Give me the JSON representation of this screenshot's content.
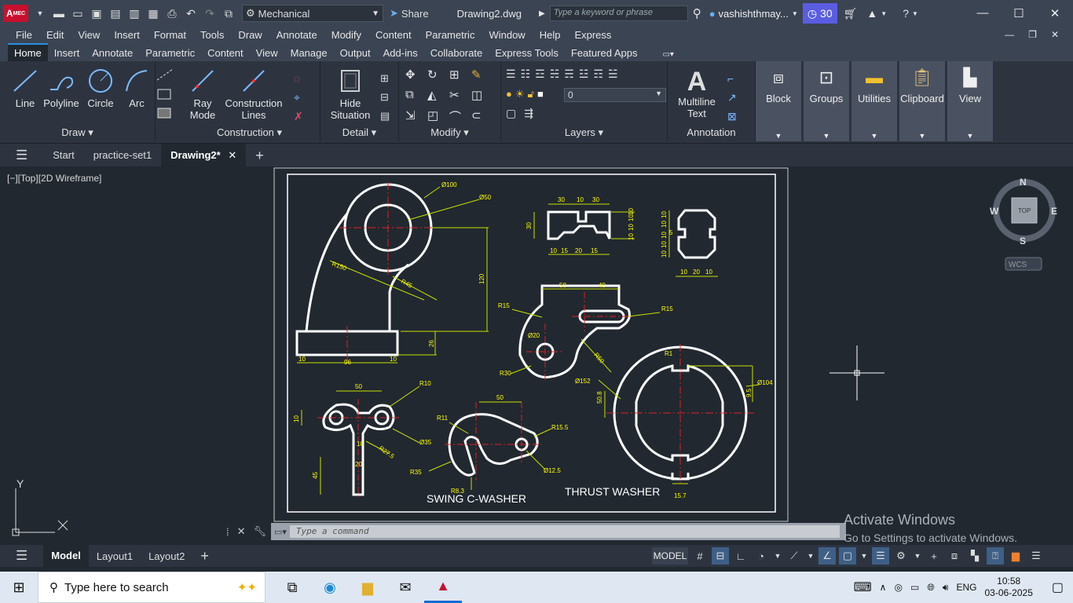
{
  "titlebar": {
    "app_badge": "A",
    "app_badge_sub": "MEC",
    "workspace": "Mechanical",
    "share_label": "Share",
    "doc_title": "Drawing2.dwg",
    "search_placeholder": "Type a keyword or phrase",
    "user_name": "vashishthmay...",
    "trial_days": "30"
  },
  "menubar": [
    "File",
    "Edit",
    "View",
    "Insert",
    "Format",
    "Tools",
    "Draw",
    "Annotate",
    "Modify",
    "Content",
    "Parametric",
    "Window",
    "Help",
    "Express"
  ],
  "ribbon_tabs": [
    "Home",
    "Insert",
    "Annotate",
    "Parametric",
    "Content",
    "View",
    "Manage",
    "Output",
    "Add-ins",
    "Collaborate",
    "Express Tools",
    "Featured Apps"
  ],
  "ribbon_active_tab": "Home",
  "ribbon": {
    "draw": {
      "title": "Draw",
      "line": "Line",
      "polyline": "Polyline",
      "circle": "Circle",
      "arc": "Arc"
    },
    "construction": {
      "title": "Construction",
      "ray_mode_1": "Ray",
      "ray_mode_2": "Mode",
      "construction_lines_1": "Construction",
      "construction_lines_2": "Lines"
    },
    "detail": {
      "title": "Detail",
      "hide_1": "Hide",
      "hide_2": "Situation"
    },
    "modify": {
      "title": "Modify"
    },
    "layers": {
      "title": "Layers",
      "current_layer": "0"
    },
    "annotation": {
      "title": "Annotation",
      "mtext_1": "Multiline",
      "mtext_2": "Text"
    },
    "block": "Block",
    "groups": "Groups",
    "utilities": "Utilities",
    "clipboard": "Clipboard",
    "view": "View"
  },
  "file_tabs": [
    "Start",
    "practice-set1",
    "Drawing2*"
  ],
  "active_file_tab": "Drawing2*",
  "viewport": {
    "label": "[−][Top][2D Wireframe]",
    "compass": {
      "n": "N",
      "s": "S",
      "e": "E",
      "w": "W",
      "top": "TOP",
      "wcs": "WCS"
    },
    "ucs_y": "Y",
    "ucs_x": "X"
  },
  "drawing": {
    "label_swing": "SWING C-WASHER",
    "label_thrust": "THRUST WASHER",
    "dims": {
      "d100": "Ø100",
      "d50": "Ø50",
      "r150": "R150",
      "r45": "R45",
      "v120": "120",
      "v26": "26",
      "h10a": "10",
      "h96": "96",
      "h10b": "10",
      "t30a": "30",
      "t10": "10",
      "t30b": "30",
      "tv30": "30",
      "tb10": "10",
      "tb15a": "15",
      "tb20": "20",
      "tb15b": "15",
      "tr1": "10",
      "tr2": "10",
      "tr3": "10",
      "tr4": "10",
      "s10a": "10",
      "s10b": "10",
      "s10c": "10",
      "s10d": "10",
      "s10e": "10",
      "s5": "5",
      "sb10a": "10",
      "sb20": "20",
      "sb10b": "10",
      "l50": "50",
      "l40": "40",
      "r15a": "R15",
      "r15b": "R15",
      "d20": "Ø20",
      "r30": "R30",
      "r50": "R50",
      "w50": "50",
      "r10": "R10",
      "w10": "10",
      "w10b": "10",
      "w20": "20",
      "w45": "45",
      "d35": "Ø35",
      "r275": "R27.5",
      "c50": "50",
      "r11": "R11",
      "r155": "R15.5",
      "r35": "R35",
      "r83": "R8.3",
      "d125": "Ø12.5",
      "d152": "Ø152",
      "r1": "R1",
      "d104": "Ø104",
      "v508": "50.8",
      "v95": "9.5",
      "v157": "15.7"
    }
  },
  "command_placeholder": "Type  a  command",
  "layout_tabs": [
    "Model",
    "Layout1",
    "Layout2"
  ],
  "active_layout": "Model",
  "status": {
    "model": "MODEL"
  },
  "activate": {
    "line1": "Activate Windows",
    "line2": "Go to Settings to activate Windows."
  },
  "taskbar": {
    "search": "Type here to search",
    "lang": "ENG",
    "time": "10:58",
    "date": "03-06-2025"
  },
  "colors": {
    "accent": "#2a8fe0",
    "dim_yellow_green": "#c8e000",
    "dim_text": "#ffff00",
    "center_red": "#e02020",
    "outline_white": "#ffffff",
    "trial_purple": "#5a5de0"
  }
}
